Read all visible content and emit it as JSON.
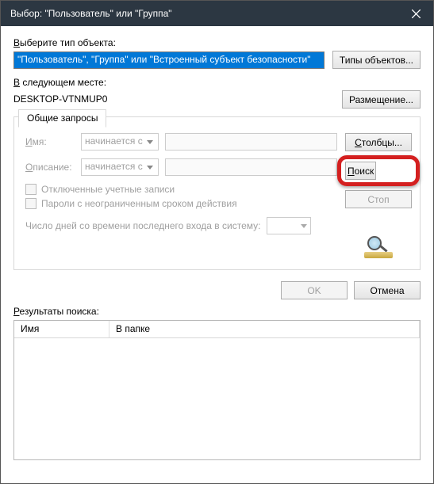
{
  "titlebar": {
    "title": "Выбор: \"Пользователь\" или \"Группа\""
  },
  "objtype": {
    "label": "Выберите тип объекта:",
    "value": "\"Пользователь\", \"Группа\" или \"Встроенный субъект безопасности\"",
    "button": "Типы объектов..."
  },
  "location": {
    "label": "В следующем месте:",
    "value": "DESKTOP-VTNMUP0",
    "button": "Размещение..."
  },
  "queries": {
    "tab": "Общие запросы",
    "name_label": "Имя:",
    "name_mode": "начинается с",
    "desc_label": "Описание:",
    "desc_mode": "начинается с",
    "chk_disabled": "Отключенные учетные записи",
    "chk_nopwd": "Пароли с неограниченным сроком действия",
    "lastlogin": "Число дней со времени последнего входа в систему:"
  },
  "sidebuttons": {
    "columns": "Столбцы...",
    "search": "Поиск",
    "stop": "Стоп"
  },
  "dlg": {
    "ok": "OK",
    "cancel": "Отмена"
  },
  "results": {
    "label": "Результаты поиска:",
    "col1": "Имя",
    "col2": "В папке"
  }
}
